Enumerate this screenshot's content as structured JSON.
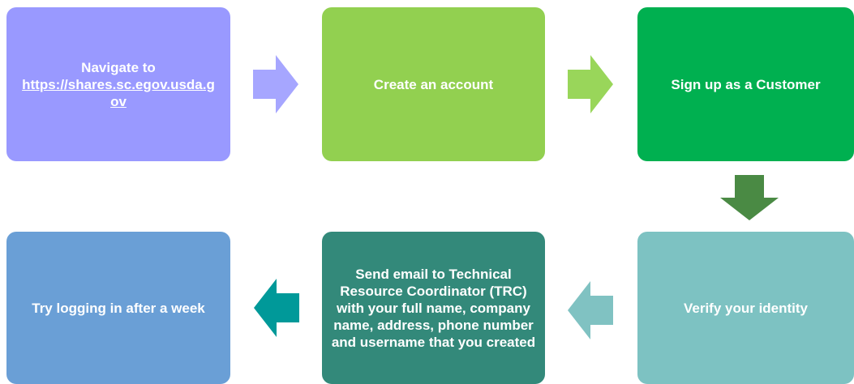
{
  "steps": [
    {
      "text": "Navigate to",
      "link": "https://shares.sc.egov.usda.gov",
      "color": "#9999FF"
    },
    {
      "text": "Create an account",
      "color": "#92D050"
    },
    {
      "text": "Sign up as a Customer",
      "color": "#00B050"
    },
    {
      "text": "Verify your identity",
      "color": "#7DC2C2"
    },
    {
      "text": "Send  email to Technical Resource Coordinator (TRC) with your full name, company name, address, phone number and username that you created",
      "color": "#33897A"
    },
    {
      "text": "Try logging in after a week",
      "color": "#6A9FD6"
    }
  ],
  "arrows": [
    {
      "direction": "right",
      "color": "#A6A6FF"
    },
    {
      "direction": "right",
      "color": "#99D65A"
    },
    {
      "direction": "down",
      "color": "#4A8A44"
    },
    {
      "direction": "left",
      "color": "#80C2C2"
    },
    {
      "direction": "left",
      "color": "#009999"
    }
  ]
}
